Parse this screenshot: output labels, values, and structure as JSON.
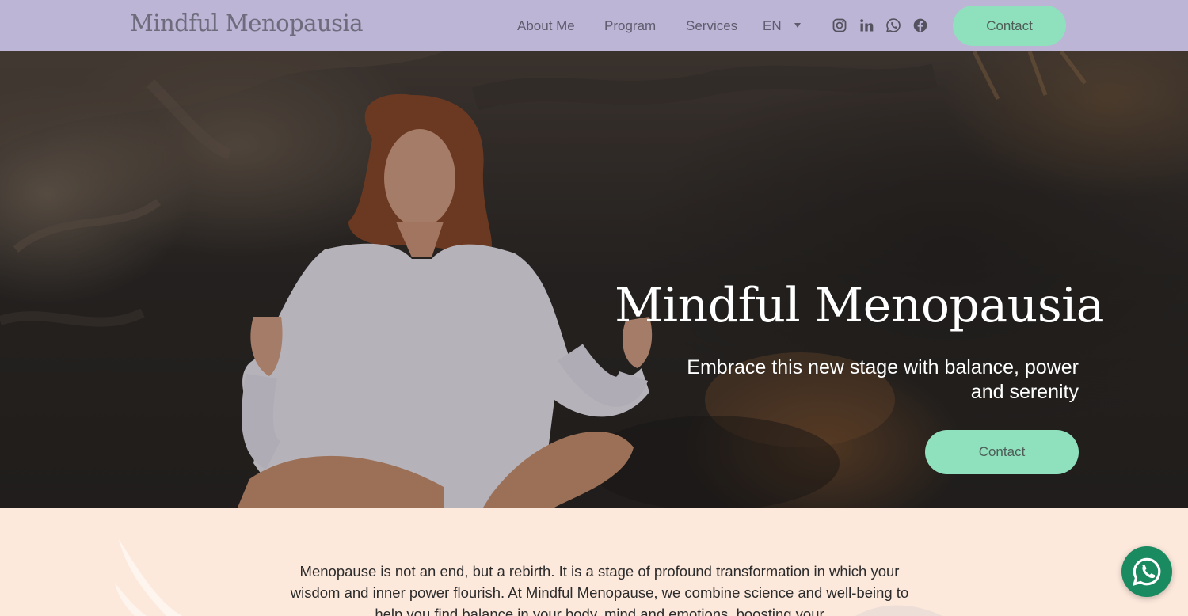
{
  "header": {
    "logo": "Mindful Menopausia",
    "nav": [
      {
        "label": "About Me"
      },
      {
        "label": "Program"
      },
      {
        "label": "Services"
      }
    ],
    "language": "EN",
    "social": [
      "instagram-icon",
      "linkedin-icon",
      "whatsapp-icon",
      "facebook-icon"
    ],
    "contact_label": "Contact"
  },
  "hero": {
    "title": "Mindful Menopausia",
    "subtitle": "Embrace this new stage with balance, power and serenity",
    "contact_label": "Contact"
  },
  "intro": {
    "text": "Menopause is not an end, but a rebirth. It is a stage of profound transformation in which your wisdom and inner power flourish. At Mindful Menopause, we combine science and well-being to help you find balance in your body, mind and emotions, boosting your"
  },
  "colors": {
    "header_bg": "#bdb5d5",
    "accent": "#8fe0bd",
    "page_bg": "#fde9dc",
    "whatsapp": "#1a8a60"
  }
}
